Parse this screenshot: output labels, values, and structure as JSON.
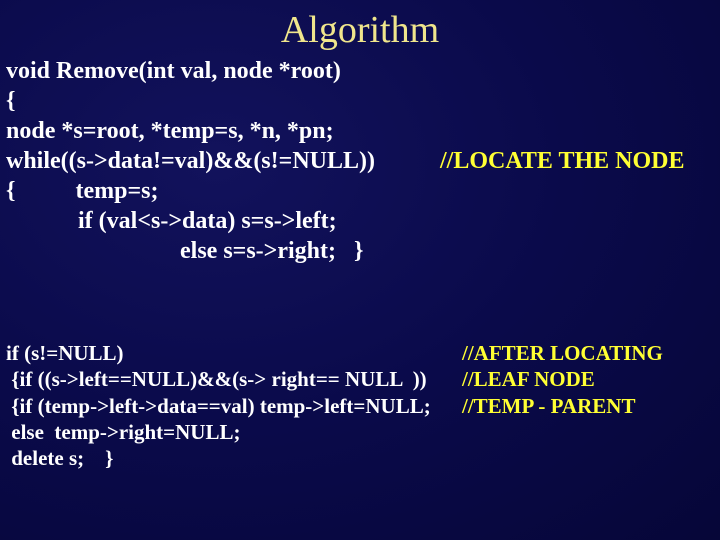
{
  "title": "Algorithm",
  "block1": {
    "l1": "void Remove(int val, node *root)",
    "l2": "{",
    "l3": "node *s=root, *temp=s, *n, *pn;",
    "l4": "while((s->data!=val)&&(s!=NULL))",
    "l5": "{          temp=s;",
    "l6": "            if (val<s->data) s=s->left;",
    "l7": "                             else s=s->right;   }"
  },
  "comment1": "//LOCATE THE NODE",
  "block2": {
    "l1": "if (s!=NULL)",
    "l2": " {if ((s->left==NULL)&&(s-> right== NULL  ))",
    "l3": " {if (temp->left->data==val) temp->left=NULL;",
    "l4": " else  temp->right=NULL;",
    "l5": " delete s;    }"
  },
  "comment2": {
    "l1": "//AFTER LOCATING",
    "l2": "//LEAF NODE",
    "l3": "//TEMP - PARENT"
  }
}
